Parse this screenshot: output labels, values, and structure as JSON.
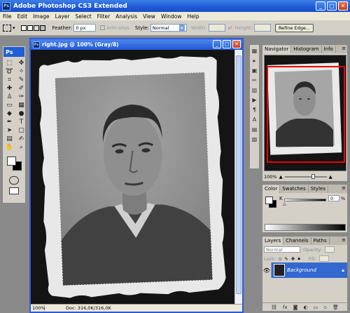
{
  "app": {
    "title": "Adobe Photoshop CS3 Extended",
    "icon": "Ps"
  },
  "menu": [
    "File",
    "Edit",
    "Image",
    "Layer",
    "Select",
    "Filter",
    "Analysis",
    "View",
    "Window",
    "Help"
  ],
  "options": {
    "feather_label": "Feather:",
    "feather_value": "0 px",
    "antialias_label": "Anti-alias",
    "style_label": "Style:",
    "style_value": "Normal",
    "width_label": "Width:",
    "height_label": "Height:",
    "refine_edge": "Refine Edge..."
  },
  "document": {
    "title": "right.jpg @ 100% (Gray/8)",
    "zoom": "100%",
    "doc_size": "Doc: 316,0K/316,0K"
  },
  "toolbox": {
    "logo": "Ps"
  },
  "navigator": {
    "tabs": [
      "Navigator",
      "Histogram",
      "Info"
    ],
    "zoom": "100%"
  },
  "color_panel": {
    "tabs": [
      "Color",
      "Swatches",
      "Styles"
    ],
    "k_label": "K",
    "k_value": "0",
    "k_unit": "%"
  },
  "layers_panel": {
    "tabs": [
      "Layers",
      "Channels",
      "Paths"
    ],
    "blend_mode": "Normal",
    "opacity_label": "Opacity:",
    "lock_label": "Lock:",
    "fill_label": "Fill:",
    "layer_name": "Background"
  }
}
